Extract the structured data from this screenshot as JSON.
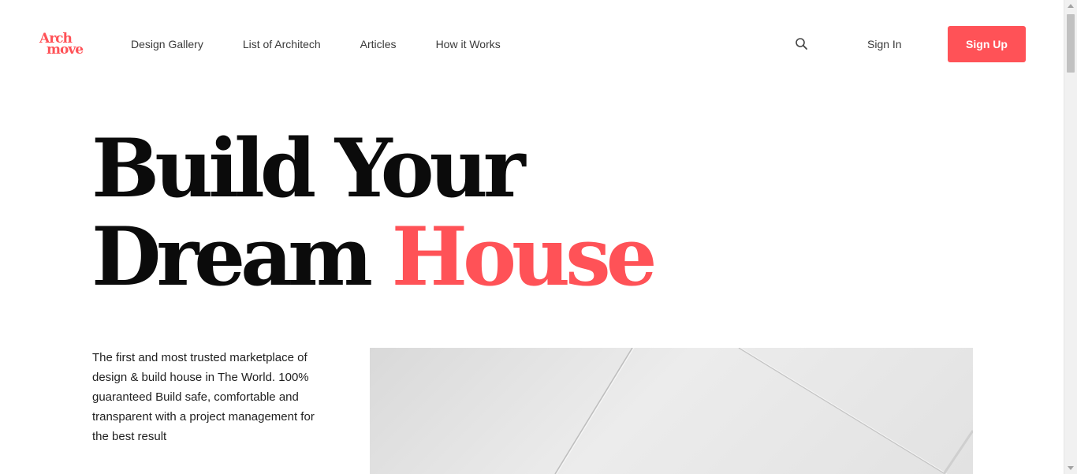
{
  "brand": {
    "logo_line1": "Arch",
    "logo_line2": "move",
    "accent_color": "#ff5257"
  },
  "nav": {
    "items": [
      {
        "label": "Design Gallery"
      },
      {
        "label": "List of Architech"
      },
      {
        "label": "Articles"
      },
      {
        "label": "How it Works"
      }
    ]
  },
  "header": {
    "search_icon": "search-icon",
    "signin_label": "Sign In",
    "signup_label": "Sign Up"
  },
  "hero": {
    "title_line1": "Build Your",
    "title_line2_part1": "Dream",
    "title_line2_accent": "House",
    "description": "The first and most trusted marketplace of design & build house in The World. 100% guaranteed Build safe, comfortable and transparent with a project management for the best result"
  }
}
